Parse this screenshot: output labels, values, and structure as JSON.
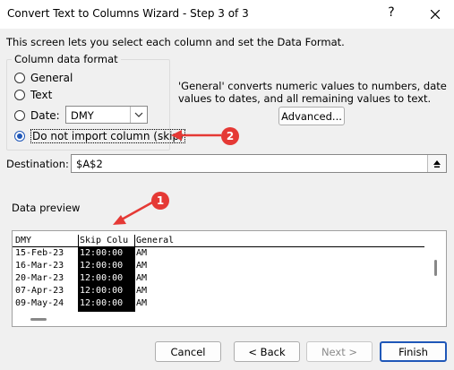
{
  "window": {
    "title": "Convert Text to Columns Wizard - Step 3 of 3",
    "help": "?"
  },
  "intro": "This screen lets you select each column and set the Data Format.",
  "format_group": {
    "legend": "Column data format",
    "options": [
      {
        "label": "General",
        "checked": false
      },
      {
        "label": "Text",
        "checked": false
      },
      {
        "label": "Date:",
        "checked": false
      },
      {
        "label": "Do not import column (skip)",
        "checked": true
      }
    ],
    "date_select": "DMY"
  },
  "description": "'General' converts numeric values to numbers, date values to dates, and all remaining values to text.",
  "advanced_label": "Advanced...",
  "destination": {
    "label": "Destination:",
    "value": "$A$2"
  },
  "preview": {
    "label": "Data preview",
    "headers": [
      "DMY",
      "Skip Colu",
      "General"
    ],
    "rows": [
      [
        "15-Feb-23",
        "12:00:00",
        "AM"
      ],
      [
        "16-Mar-23",
        "12:00:00",
        "AM"
      ],
      [
        "20-Mar-23",
        "12:00:00",
        "AM"
      ],
      [
        "07-Apr-23",
        "12:00:00",
        "AM"
      ],
      [
        "09-May-24",
        "12:00:00",
        "AM"
      ]
    ]
  },
  "annotations": {
    "badge1": "1",
    "badge2": "2"
  },
  "buttons": {
    "cancel": "Cancel",
    "back": "< Back",
    "next": "Next >",
    "finish": "Finish"
  },
  "colors": {
    "accent": "#1f57b8",
    "annotation": "#e53935"
  }
}
